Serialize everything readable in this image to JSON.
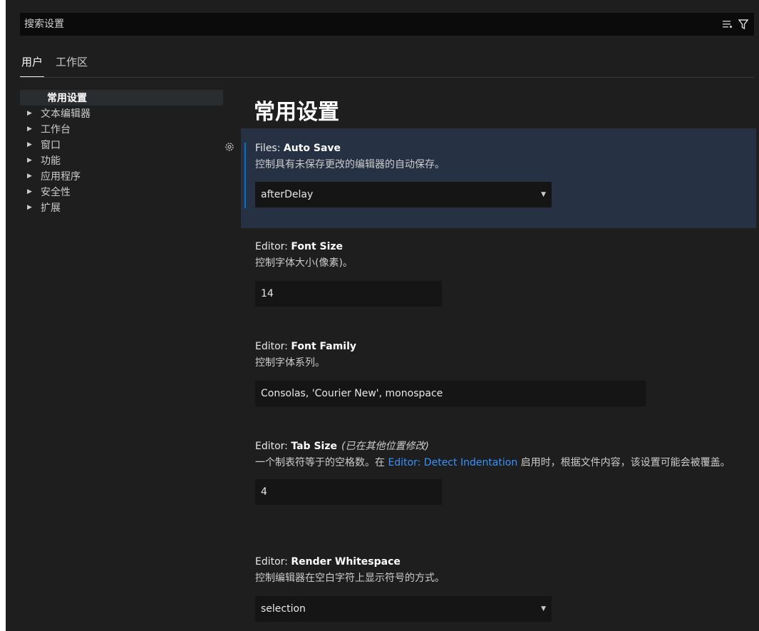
{
  "search": {
    "placeholder": "搜索设置"
  },
  "icons": {
    "clear_filter": "list-filter-icon",
    "filter": "funnel-icon",
    "gear": "gear-icon",
    "caret": "triangle-down-icon"
  },
  "tabs": [
    {
      "label": "用户",
      "active": true
    },
    {
      "label": "工作区",
      "active": false
    }
  ],
  "toc": [
    {
      "label": "常用设置",
      "active": true
    },
    {
      "label": "文本编辑器"
    },
    {
      "label": "工作台"
    },
    {
      "label": "窗口"
    },
    {
      "label": "功能"
    },
    {
      "label": "应用程序"
    },
    {
      "label": "安全性"
    },
    {
      "label": "扩展"
    }
  ],
  "section_title": "常用设置",
  "settings": {
    "auto_save": {
      "category": "Files: ",
      "name": "Auto Save",
      "description": "控制具有未保存更改的编辑器的自动保存。",
      "value": "afterDelay"
    },
    "font_size": {
      "category": "Editor: ",
      "name": "Font Size",
      "description": "控制字体大小(像素)。",
      "value": "14"
    },
    "font_family": {
      "category": "Editor: ",
      "name": "Font Family",
      "description": "控制字体系列。",
      "value": "Consolas, 'Courier New', monospace"
    },
    "tab_size": {
      "category": "Editor: ",
      "name": "Tab Size",
      "modified": "(已在其他位置修改)",
      "description_before": "一个制表符等于的空格数。在 ",
      "description_link": "Editor: Detect Indentation",
      "description_after": " 启用时，根据文件内容，该设置可能会被覆盖。",
      "value": "4"
    },
    "render_whitespace": {
      "category": "Editor: ",
      "name": "Render Whitespace",
      "description": "控制编辑器在空白字符上显示符号的方式。",
      "value": "selection"
    }
  },
  "colors": {
    "background": "#1e1e1e",
    "focused_row": "#263244",
    "accent_bar": "#0e70c0",
    "link": "#3794ff"
  }
}
